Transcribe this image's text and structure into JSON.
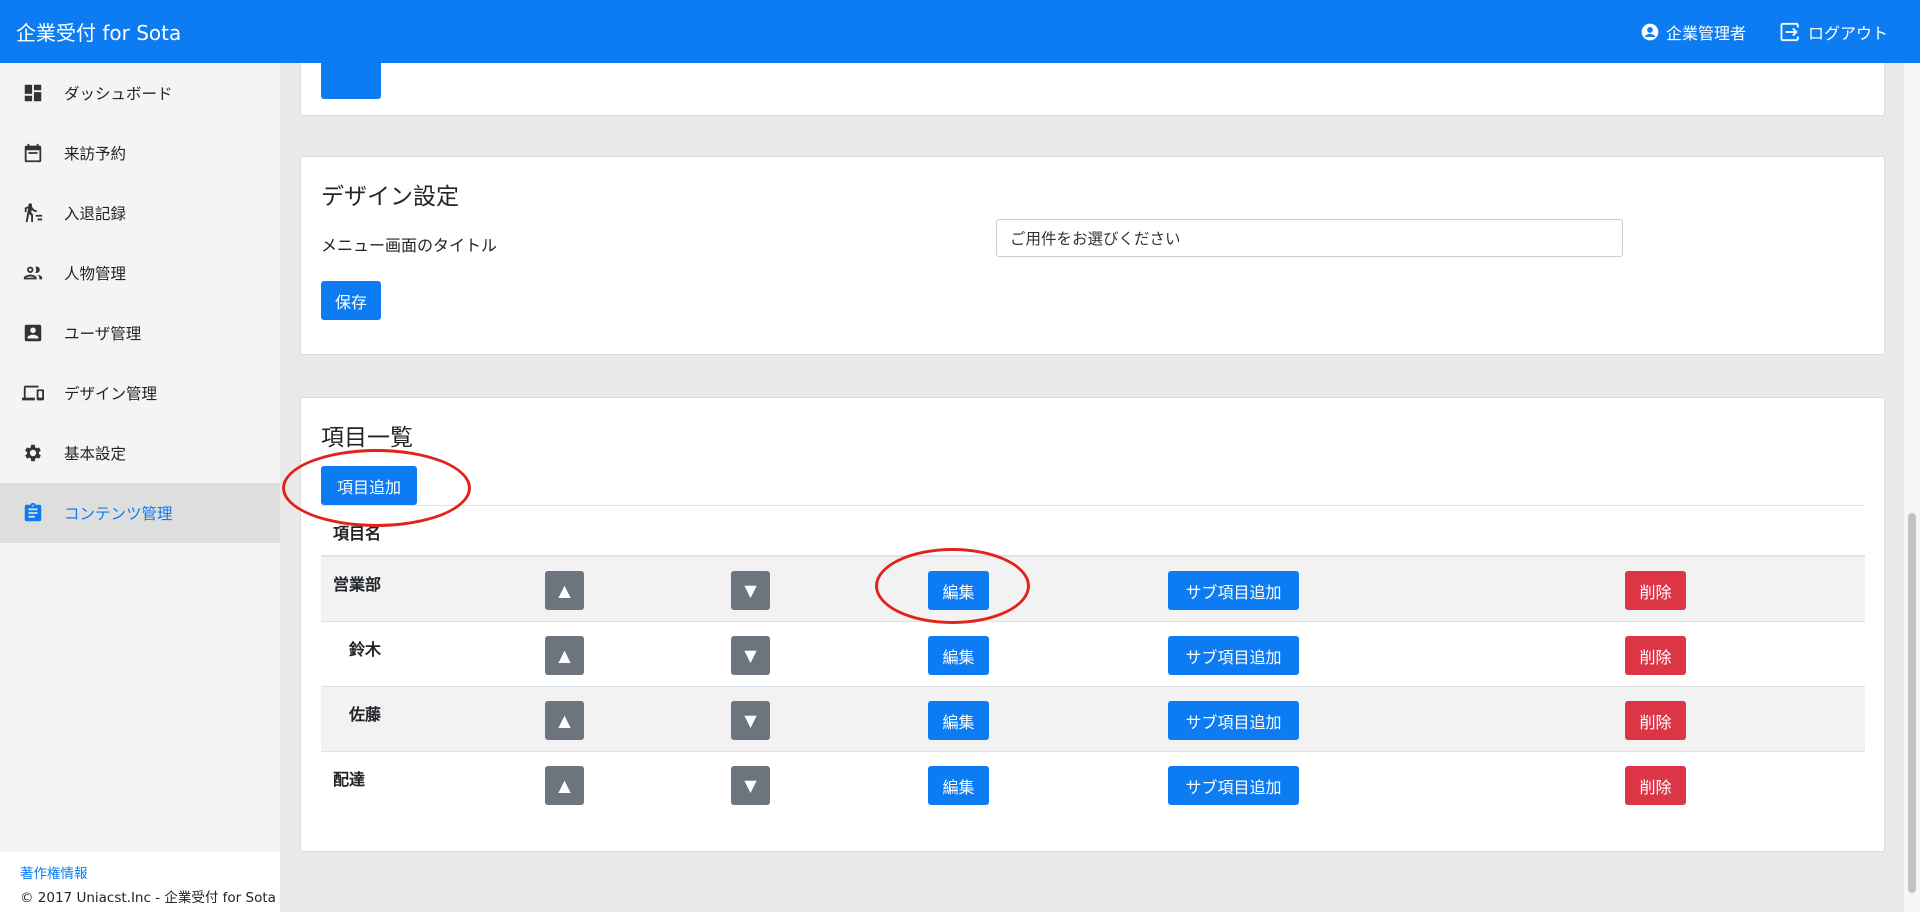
{
  "app": {
    "title": "企業受付 for Sota"
  },
  "header": {
    "user_label": "企業管理者",
    "logout_label": "ログアウト"
  },
  "sidebar": {
    "items": [
      {
        "label": "ダッシュボード",
        "icon": "dashboard-icon"
      },
      {
        "label": "来訪予約",
        "icon": "calendar-icon"
      },
      {
        "label": "入退記録",
        "icon": "walking-icon"
      },
      {
        "label": "人物管理",
        "icon": "people-icon"
      },
      {
        "label": "ユーザ管理",
        "icon": "user-card-icon"
      },
      {
        "label": "デザイン管理",
        "icon": "devices-icon"
      },
      {
        "label": "基本設定",
        "icon": "gear-icon"
      },
      {
        "label": "コンテンツ管理",
        "icon": "clipboard-icon",
        "active": true
      }
    ],
    "footer_link": "著作権情報",
    "footer_text": "© 2017 Uniacst.Inc - 企業受付 for Sota"
  },
  "design_card": {
    "title": "デザイン設定",
    "field_label": "メニュー画面のタイトル",
    "field_value": "ご用件をお選びください",
    "save_label": "保存"
  },
  "items_card": {
    "title": "項目一覧",
    "add_label": "項目追加",
    "col_name": "項目名",
    "up_label": "▲",
    "down_label": "▼",
    "edit_label": "編集",
    "sub_add_label": "サブ項目追加",
    "delete_label": "削除",
    "rows": [
      {
        "name": "営業部",
        "level": 0
      },
      {
        "name": "鈴木",
        "level": 1
      },
      {
        "name": "佐藤",
        "level": 1
      },
      {
        "name": "配達",
        "level": 0
      }
    ]
  },
  "colors": {
    "primary": "#0d7cf2",
    "danger": "#dc3545",
    "secondary": "#6c757d",
    "annotation": "#e0241c"
  }
}
